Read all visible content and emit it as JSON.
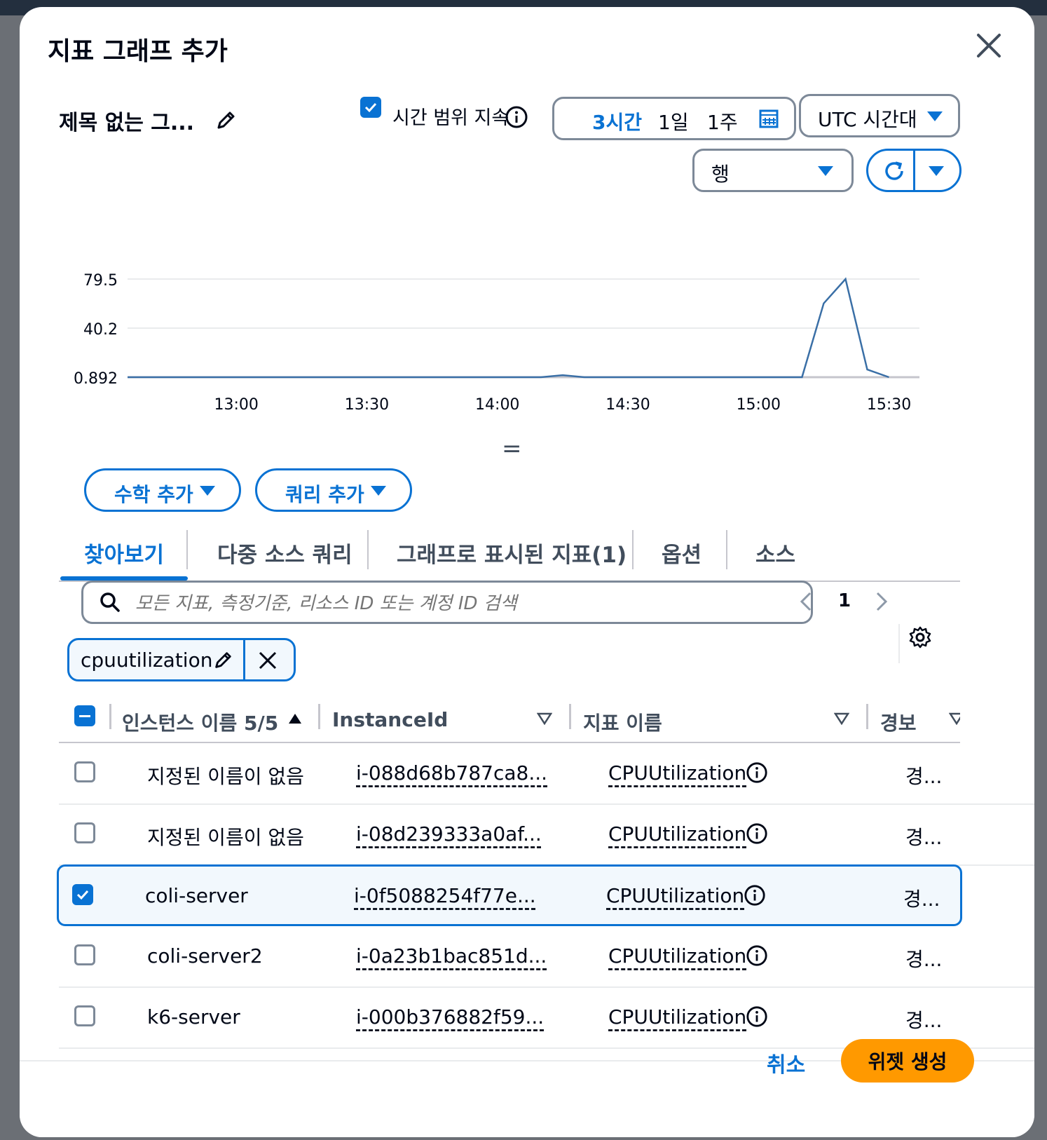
{
  "modal": {
    "title": "지표 그래프 추가",
    "graph_title": "제목 없는 그...",
    "persist_label": "시간 범위 지속",
    "time_ranges": [
      "3시간",
      "1일",
      "1주"
    ],
    "timezone": "UTC 시간대",
    "view_type": "행",
    "add_math": "수학 추가",
    "add_query": "쿼리 추가",
    "splitter": "="
  },
  "tabs": [
    "찾아보기",
    "다중 소스 쿼리",
    "그래프로 표시된 지표(1)",
    "옵션",
    "소스"
  ],
  "search": {
    "placeholder": "모든 지표, 측정기준, 리소스 ID 또는 계정 ID 검색",
    "page": "1"
  },
  "filter_token": "cpuutilization",
  "table": {
    "headers": [
      "인스턴스 이름 5/5",
      "InstanceId",
      "지표 이름",
      "경보"
    ],
    "rows": [
      {
        "name": "지정된 이름이 없음",
        "instance_id": "i-088d68b787ca8...",
        "metric": "CPUUtilization",
        "alarm": "경...",
        "checked": false
      },
      {
        "name": "지정된 이름이 없음",
        "instance_id": "i-08d239333a0af...",
        "metric": "CPUUtilization",
        "alarm": "경...",
        "checked": false
      },
      {
        "name": "coli-server",
        "instance_id": "i-0f5088254f77e...",
        "metric": "CPUUtilization",
        "alarm": "경...",
        "checked": true
      },
      {
        "name": "coli-server2",
        "instance_id": "i-0a23b1bac851d...",
        "metric": "CPUUtilization",
        "alarm": "경...",
        "checked": false
      },
      {
        "name": "k6-server",
        "instance_id": "i-000b376882f59...",
        "metric": "CPUUtilization",
        "alarm": "경...",
        "checked": false
      }
    ]
  },
  "footer": {
    "cancel": "취소",
    "create": "위젯 생성"
  },
  "colors": {
    "accent": "#0972d3",
    "primary_button": "#ff9900",
    "line": "#3a6fa6"
  },
  "chart_data": {
    "type": "line",
    "yticks": [
      "79.5",
      "40.2",
      "0.892"
    ],
    "xticks": [
      "13:00",
      "13:30",
      "14:00",
      "14:30",
      "15:00",
      "15:30"
    ],
    "ylim": [
      0.892,
      79.5
    ],
    "x": [
      "12:35",
      "12:45",
      "12:55",
      "13:05",
      "13:15",
      "13:25",
      "13:35",
      "13:45",
      "13:55",
      "14:05",
      "14:10",
      "14:15",
      "14:20",
      "14:25",
      "14:35",
      "14:45",
      "14:55",
      "15:05",
      "15:10",
      "15:15",
      "15:20",
      "15:25",
      "15:30"
    ],
    "series": [
      {
        "values": [
          0.892,
          0.892,
          0.892,
          0.892,
          0.892,
          0.892,
          0.892,
          0.892,
          0.892,
          0.892,
          0.892,
          2.5,
          0.892,
          0.892,
          0.892,
          0.892,
          0.892,
          0.892,
          0.892,
          60,
          79.5,
          7,
          0.892
        ]
      }
    ]
  }
}
